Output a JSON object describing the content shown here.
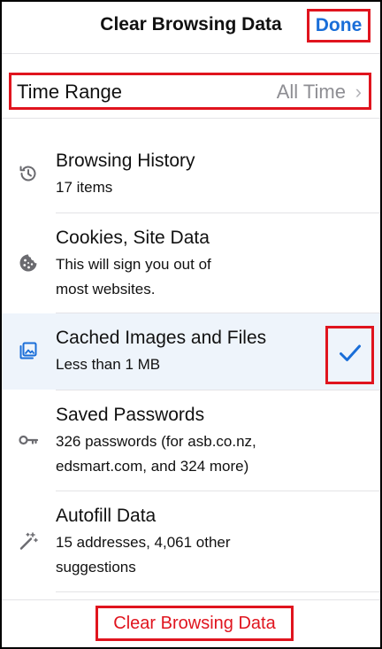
{
  "header": {
    "title": "Clear Browsing Data",
    "done_label": "Done"
  },
  "time_range": {
    "label": "Time Range",
    "value": "All Time"
  },
  "items": [
    {
      "title": "Browsing History",
      "subtitle": [
        "17 items"
      ],
      "icon": "history-icon",
      "selected": false
    },
    {
      "title": "Cookies, Site Data",
      "subtitle": [
        "This will sign you out of",
        "most websites."
      ],
      "icon": "cookie-icon",
      "selected": false
    },
    {
      "title": "Cached Images and Files",
      "subtitle": [
        "Less than 1 MB"
      ],
      "icon": "image-icon",
      "selected": true
    },
    {
      "title": "Saved Passwords",
      "subtitle": [
        "326 passwords (for asb.co.nz,",
        "edsmart.com, and 324 more)"
      ],
      "icon": "key-icon",
      "selected": false
    },
    {
      "title": "Autofill Data",
      "subtitle": [
        "15 addresses, 4,061 other",
        "suggestions"
      ],
      "icon": "magic-wand-icon",
      "selected": false
    }
  ],
  "clear_button_label": "Clear Browsing Data",
  "colors": {
    "accent_blue": "#1a6ed8",
    "destructive_red": "#e0141e",
    "selected_row_bg": "#eef4fb"
  }
}
